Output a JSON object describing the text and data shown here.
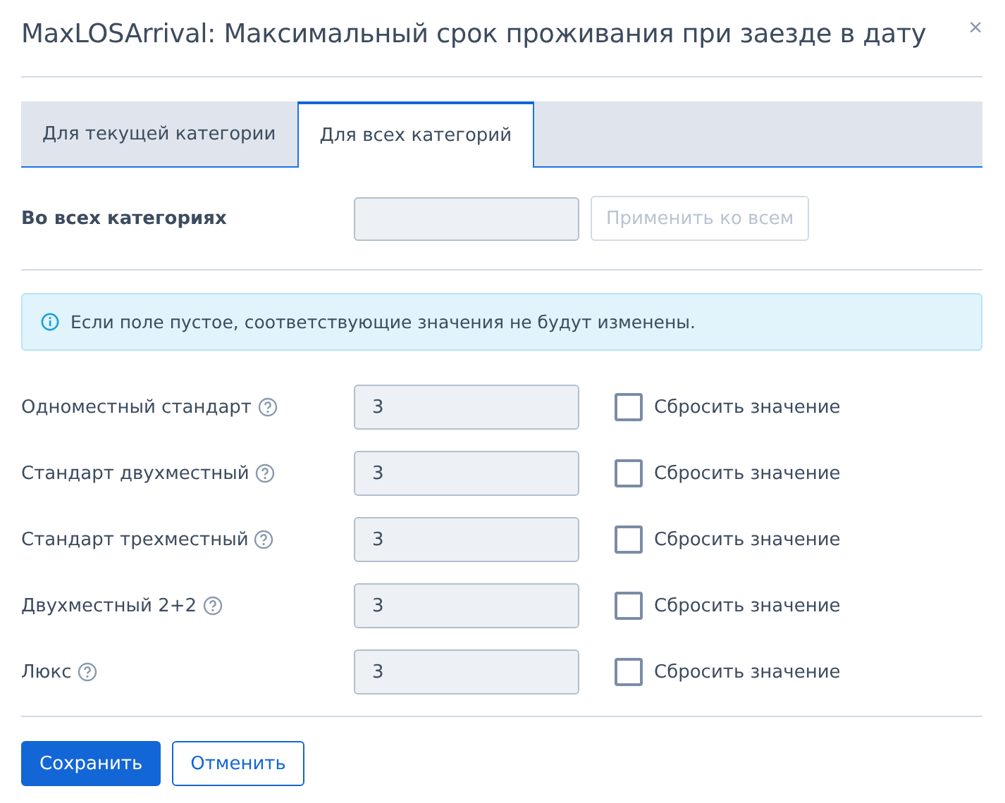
{
  "dialog": {
    "title": "MaxLOSArrival: Максимальный срок проживания при заезде в дату",
    "close": "×"
  },
  "tabs": [
    {
      "label": "Для текущей категории",
      "selected": false
    },
    {
      "label": "Для всех категорий",
      "selected": true
    }
  ],
  "all_categories": {
    "label": "Во всех категориях",
    "apply_button": {
      "label": "Применить ко всем",
      "disabled": true
    }
  },
  "info": "Если поле пустое, соответствующие значения не будут изменены.",
  "rows": [
    {
      "name": "Одноместный стандарт",
      "value": "3",
      "reset_label": "Сбросить значение",
      "checked": false
    },
    {
      "name": "Стандарт двухместный",
      "value": "3",
      "reset_label": "Сбросить значение",
      "checked": false
    },
    {
      "name": "Стандарт трехместный",
      "value": "3",
      "reset_label": "Сбросить значение",
      "checked": false
    },
    {
      "name": "Двухместный 2+2",
      "value": "3",
      "reset_label": "Сбросить значение",
      "checked": false
    },
    {
      "name": "Люкс",
      "value": "3",
      "reset_label": "Сбросить значение",
      "checked": false
    }
  ],
  "buttons": {
    "save": "Сохранить",
    "cancel": "Отменить"
  }
}
